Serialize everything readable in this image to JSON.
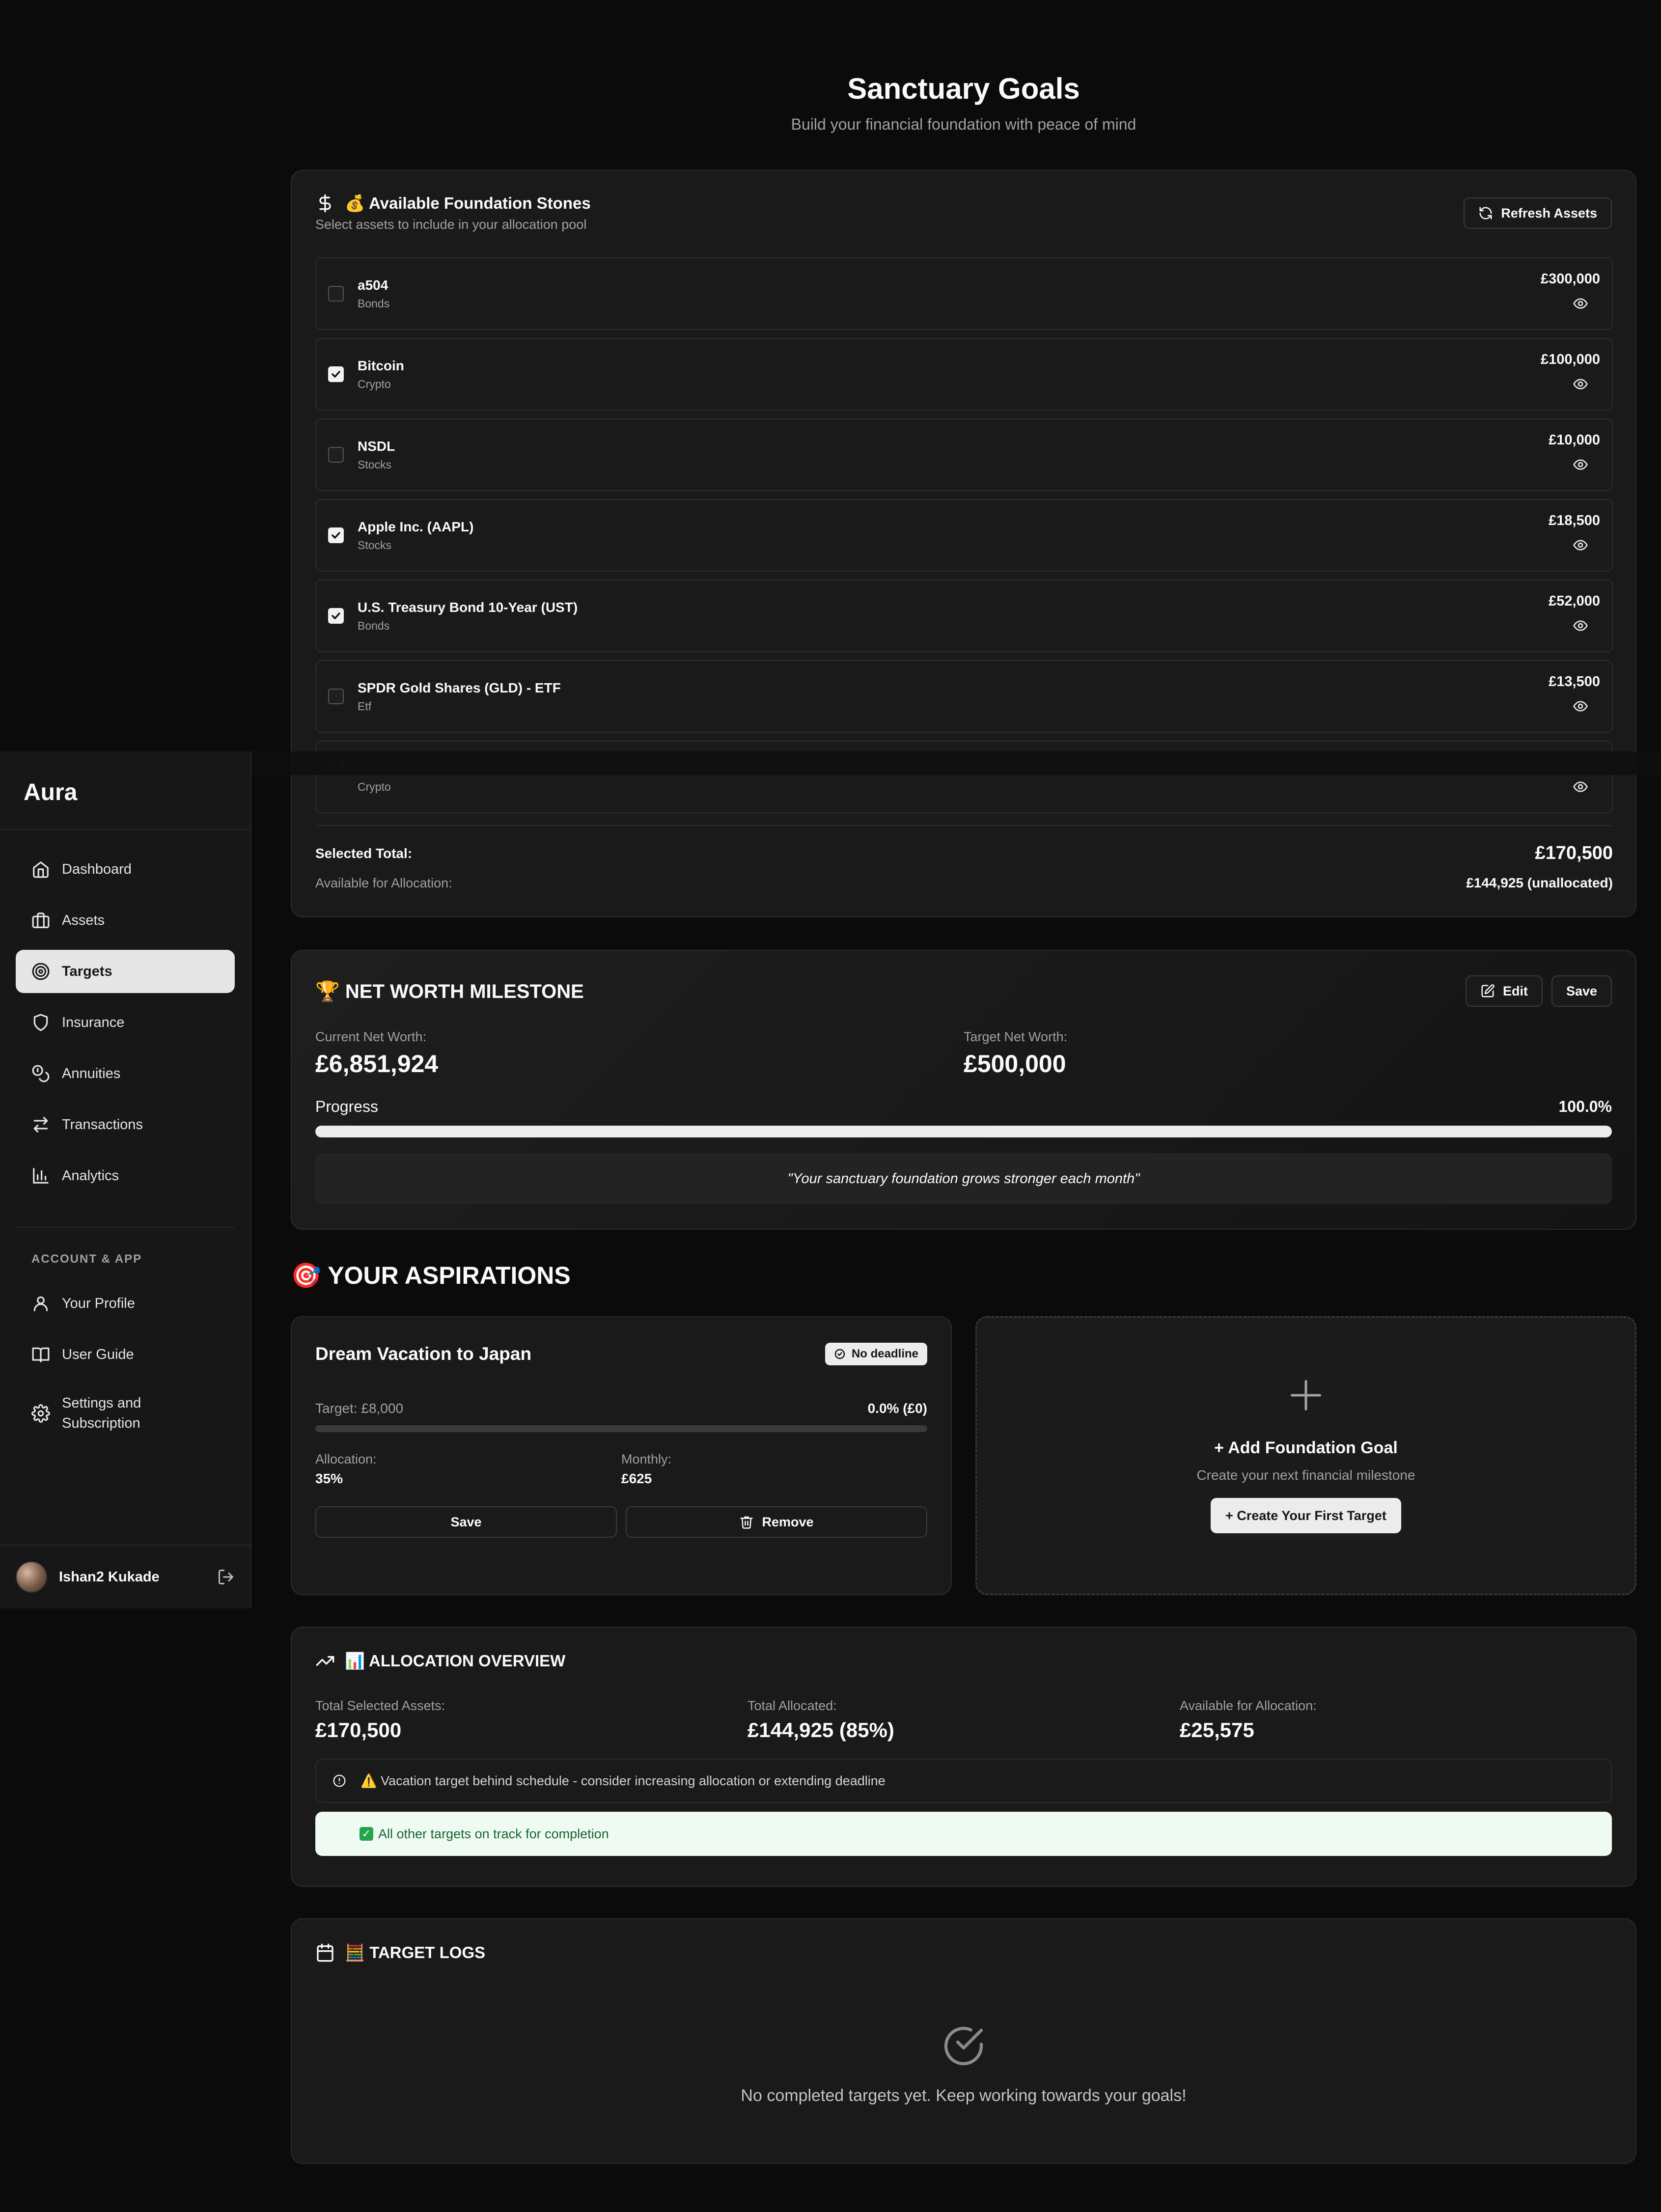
{
  "sidebar": {
    "brand": "Aura",
    "nav": [
      {
        "label": "Dashboard",
        "icon": "home-icon"
      },
      {
        "label": "Assets",
        "icon": "briefcase-icon"
      },
      {
        "label": "Targets",
        "icon": "target-icon",
        "active": true
      },
      {
        "label": "Insurance",
        "icon": "shield-icon"
      },
      {
        "label": "Annuities",
        "icon": "coins-icon"
      },
      {
        "label": "Transactions",
        "icon": "arrows-icon"
      },
      {
        "label": "Analytics",
        "icon": "bar-chart-icon"
      }
    ],
    "section_label": "ACCOUNT & APP",
    "account_nav": [
      {
        "label": "Your Profile",
        "icon": "user-icon"
      },
      {
        "label": "User Guide",
        "icon": "book-icon"
      },
      {
        "label": "Settings and Subscription",
        "icon": "gear-icon"
      }
    ],
    "user": {
      "name": "Ishan2 Kukade"
    }
  },
  "header": {
    "title": "Sanctuary Goals",
    "subtitle": "Build your financial foundation with peace of mind"
  },
  "assets_card": {
    "title": "💰 Available Foundation Stones",
    "subtitle": "Select assets to include in your allocation pool",
    "refresh_label": "Refresh Assets",
    "items": [
      {
        "name": "a504",
        "type": "Bonds",
        "value": "£300,000",
        "checked": false
      },
      {
        "name": "Bitcoin",
        "type": "Crypto",
        "value": "£100,000",
        "checked": true
      },
      {
        "name": "NSDL",
        "type": "Stocks",
        "value": "£10,000",
        "checked": false
      },
      {
        "name": "Apple Inc. (AAPL)",
        "type": "Stocks",
        "value": "£18,500",
        "checked": true
      },
      {
        "name": "U.S. Treasury Bond 10-Year (UST)",
        "type": "Bonds",
        "value": "£52,000",
        "checked": true
      },
      {
        "name": "SPDR Gold Shares (GLD) - ETF",
        "type": "Etf",
        "value": "£13,500",
        "checked": false
      },
      {
        "name": "",
        "type": "Crypto",
        "value": "",
        "checked": false
      }
    ],
    "selected_total_label": "Selected Total:",
    "selected_total_value": "£170,500",
    "available_label": "Available for Allocation:",
    "available_value": "£144,925 (unallocated)"
  },
  "milestone": {
    "title": "🏆 NET WORTH MILESTONE",
    "edit_label": "Edit",
    "save_label": "Save",
    "current_label": "Current Net Worth:",
    "current_value": "£6,851,924",
    "target_label": "Target Net Worth:",
    "target_value": "£500,000",
    "progress_label": "Progress",
    "progress_value": "100.0%",
    "progress_fraction": 1.0,
    "quote": "\"Your sanctuary foundation grows stronger each month\""
  },
  "aspirations": {
    "title": "🎯 YOUR ASPIRATIONS",
    "goal": {
      "title": "Dream Vacation to Japan",
      "badge": "No deadline",
      "target_label": "Target: £8,000",
      "progress_label": "0.0% (£0)",
      "allocation_label": "Allocation:",
      "allocation_value": "35%",
      "monthly_label": "Monthly:",
      "monthly_value": "£625",
      "save_label": "Save",
      "remove_label": "Remove"
    },
    "add": {
      "title": "+ Add Foundation Goal",
      "subtitle": "Create your next financial milestone",
      "button": "+ Create Your First Target"
    }
  },
  "allocation": {
    "title": "📊 ALLOCATION OVERVIEW",
    "total_selected_label": "Total Selected Assets:",
    "total_selected_value": "£170,500",
    "total_allocated_label": "Total Allocated:",
    "total_allocated_value": "£144,925 (85%)",
    "available_label": "Available for Allocation:",
    "available_value": "£25,575",
    "warning": "⚠️ Vacation target behind schedule - consider increasing allocation or extending deadline",
    "success": "All other targets on track for completion"
  },
  "logs": {
    "title": "🧮 TARGET LOGS",
    "empty": "No completed targets yet. Keep working towards your goals!"
  }
}
